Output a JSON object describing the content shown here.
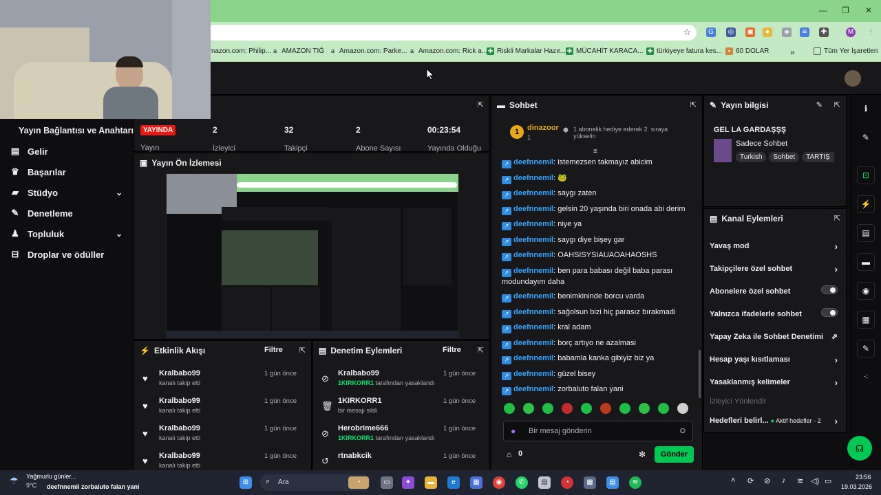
{
  "browser": {
    "bookmarks": [
      {
        "label": "mazon.com: Philip...",
        "icon": "amazon-icon"
      },
      {
        "label": "AMAZON TIĞ",
        "icon": "amazon-icon"
      },
      {
        "label": "Amazon.com: Parke...",
        "icon": "amazon-icon"
      },
      {
        "label": "Amazon.com: Rick a...",
        "icon": "amazon-icon"
      },
      {
        "label": "Riskli Markalar Hazır...",
        "icon": "sheets-icon"
      },
      {
        "label": "MÜCAHİT KARACA...",
        "icon": "sheets-icon"
      },
      {
        "label": "türkiyeye fatura kes...",
        "icon": "sheets-icon"
      },
      {
        "label": "60 DOLAR",
        "icon": "folder-icon"
      }
    ],
    "more_bookmarks": "»",
    "all_bookmarks": "Tüm Yer İşaretleri",
    "profile_initial": "M"
  },
  "leftnav": {
    "title": "Yayın Bağlantısı ve Anahtarı",
    "items": [
      {
        "label": "Gelir",
        "icon": "revenue-icon"
      },
      {
        "label": "Başarılar",
        "icon": "trophy-icon"
      },
      {
        "label": "Stüdyo",
        "icon": "studio-icon",
        "expandable": true
      },
      {
        "label": "Denetleme",
        "icon": "wrench-icon"
      },
      {
        "label": "Topluluk",
        "icon": "community-icon",
        "expandable": true
      },
      {
        "label": "Droplar ve ödüller",
        "icon": "drops-icon"
      }
    ]
  },
  "stats": {
    "header_partial": "i",
    "live_badge": "YAYINDA",
    "live_label": "Yayın",
    "viewers": {
      "value": "2",
      "label": "İzleyici"
    },
    "followers": {
      "value": "32",
      "label": "Takipçi"
    },
    "subs": {
      "value": "2",
      "label": "Abone Sayısı"
    },
    "uptime": {
      "value": "00:23:54",
      "label": "Yayında Olduğu"
    }
  },
  "preview": {
    "title": "Yayın Ön İzlemesi"
  },
  "activity": {
    "title": "Etkinlik Akışı",
    "filter": "Filtre",
    "items": [
      {
        "name": "Kralbabo99",
        "action": "kanalı takip etti",
        "time": "1 gün önce"
      },
      {
        "name": "Kralbabo99",
        "action": "kanalı takip etti",
        "time": "1 gün önce"
      },
      {
        "name": "Kralbabo99",
        "action": "kanalı takip etti",
        "time": "1 gün önce"
      },
      {
        "name": "Kralbabo99",
        "action": "kanalı takip etti",
        "time": "1 gün önce"
      }
    ]
  },
  "moderation": {
    "title": "Denetim Eylemleri",
    "filter": "Filtre",
    "items": [
      {
        "name": "Kralbabo99",
        "actor": "1KIRKORR1",
        "action": "tarafından yasaklandı",
        "time": "1 gün önce",
        "icon": "ban-icon"
      },
      {
        "name": "1KIRKORR1",
        "actor": "",
        "action": "bir mesajı sildi",
        "time": "1 gün önce",
        "icon": "trash-icon"
      },
      {
        "name": "Herobrime666",
        "actor": "1KIRKORR1",
        "action": "tarafından yasaklandı",
        "time": "1 gün önce",
        "icon": "ban-icon"
      },
      {
        "name": "rtnabkcik",
        "actor": "",
        "action": "",
        "time": "1 gün önce",
        "icon": "undo-icon"
      }
    ]
  },
  "chat": {
    "title": "Sohbet",
    "pinned_user": "dinazoor",
    "pinned_rank": "1",
    "pinned_count": "1",
    "hype_text": "1 abonelik hediye ederek 2. sıraya yükselin",
    "messages": [
      {
        "user": "deefnnemil",
        "text": "istemezsen takmayız abicim"
      },
      {
        "user": "deefnnemil",
        "text": ""
      },
      {
        "user": "deefnnemil",
        "text": "saygı zaten"
      },
      {
        "user": "deefnnemil",
        "text": "gelsin 20 yaşında biri onada abi derim"
      },
      {
        "user": "deefnnemil",
        "text": "niye ya"
      },
      {
        "user": "deefnnemil",
        "text": "saygı diye bişey gar"
      },
      {
        "user": "deefnnemil",
        "text": "OAHSISYSIAUAOAHAOSHS"
      },
      {
        "user": "deefnnemil",
        "text": "ben para babası değil baba parası modundayım daha"
      },
      {
        "user": "deefnnemil",
        "text": "benimkininde borcu varda"
      },
      {
        "user": "deefnnemil",
        "text": "sağolsun bizi hiç parasız bırakmadi"
      },
      {
        "user": "deefnnemil",
        "text": "kral adam"
      },
      {
        "user": "deefnnemil",
        "text": "borç artıyo ne azalmasi"
      },
      {
        "user": "deefnnemil",
        "text": "babamla kanka gibiyiz biz ya"
      },
      {
        "user": "deefnnemil",
        "text": "güzel bisey"
      },
      {
        "user": "deefnnemil",
        "text": "zorbaluto falan yani"
      }
    ],
    "input_placeholder": "Bir mesaj gönderin",
    "points": "0",
    "send_label": "Gönder"
  },
  "stream_info": {
    "title": "Yayın bilgisi",
    "stream_title": "GEL LA GARDAŞŞŞ",
    "category": "Sadece Sohbet",
    "tags": [
      "Turkish",
      "Sohbet",
      "TARTIŞ"
    ]
  },
  "channel_actions": {
    "title": "Kanal Eylemleri",
    "items": [
      {
        "label": "Yavaş mod",
        "control": "chevron"
      },
      {
        "label": "Takipçilere özel sohbet",
        "control": "chevron"
      },
      {
        "label": "Abonelere özel sohbet",
        "control": "toggle"
      },
      {
        "label": "Yalnızca ifadelerle sohbet",
        "control": "toggle"
      },
      {
        "label": "Yapay Zeka ile Sohbet Denetimi",
        "control": "external"
      },
      {
        "label": "Hesap yaşı kısıtlaması",
        "control": "chevron"
      },
      {
        "label": "Yasaklanmış kelimeler",
        "control": "chevron"
      }
    ],
    "dim_label": "İzleyici Yönlendir",
    "goals_label": "Hedefleri belirl...",
    "goals_status": "Aktif hedefler - 2"
  },
  "taskbar": {
    "weather_title": "Yağmurlu günler...",
    "weather_temp": "9°C",
    "notif_user": "deefnnemil",
    "notif_text": "zorbaluto falan yani",
    "search_label": "Ara",
    "time": "23:56",
    "date": "19.03.2026"
  }
}
